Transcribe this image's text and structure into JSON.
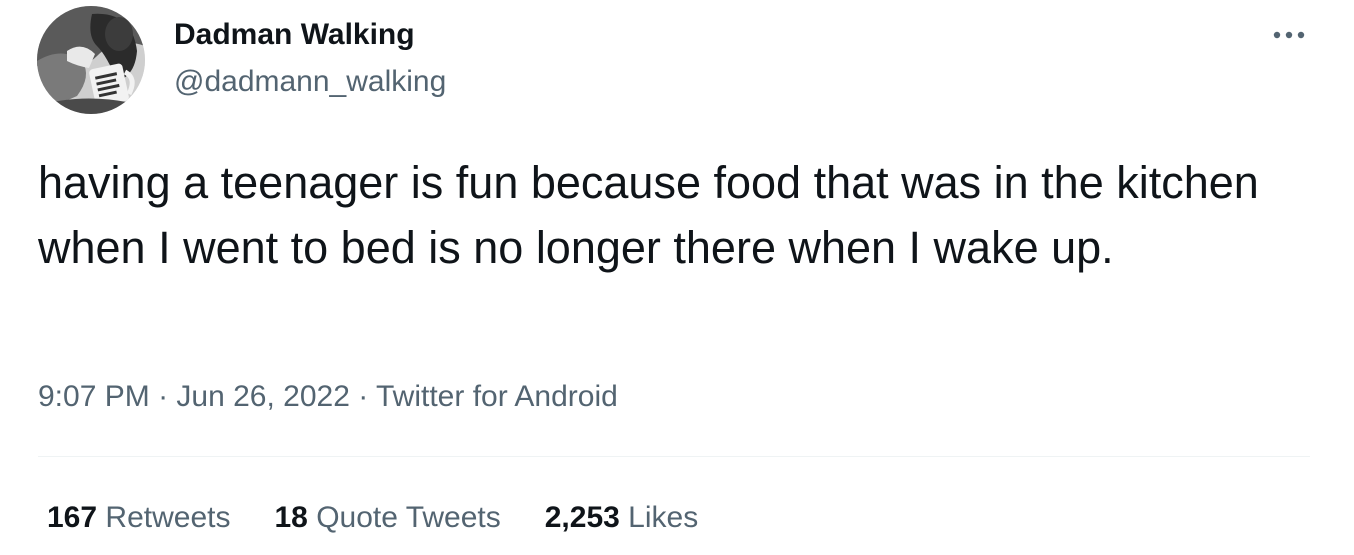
{
  "author": {
    "display_name": "Dadman Walking",
    "handle": "@dadmann_walking",
    "avatar_icon": "user-avatar-photo"
  },
  "more_icon": "more-horizontal-icon",
  "tweet": {
    "text": "having a teenager is fun because food that was in the kitchen when I went to bed is no longer there when I wake up."
  },
  "meta": {
    "time": "9:07 PM",
    "separator": " · ",
    "date": "Jun 26, 2022",
    "source": "Twitter for Android"
  },
  "stats": {
    "retweets_count": "167",
    "retweets_label": "Retweets",
    "quotes_count": "18",
    "quotes_label": "Quote Tweets",
    "likes_count": "2,253",
    "likes_label": "Likes"
  },
  "colors": {
    "primary_text": "#0f1419",
    "secondary_text": "#536471",
    "divider": "#eff3f4"
  }
}
